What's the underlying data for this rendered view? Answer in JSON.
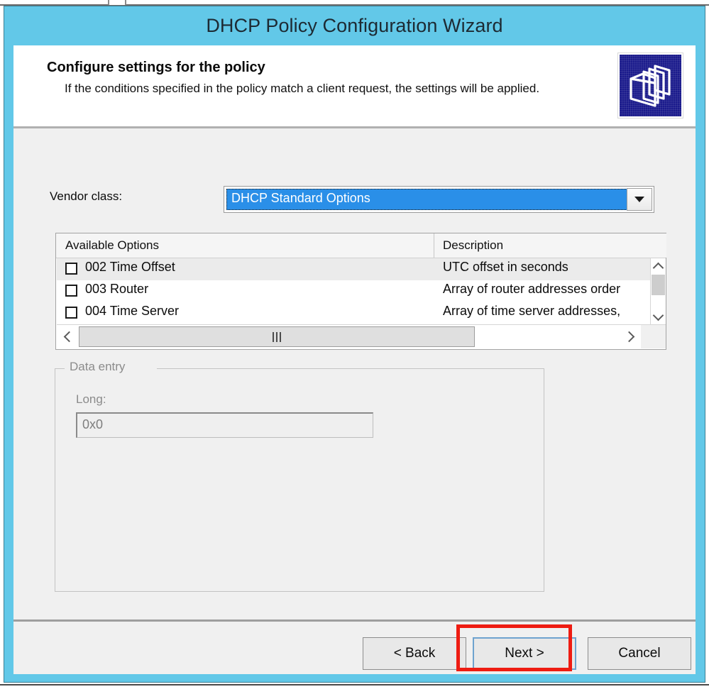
{
  "window": {
    "title": "DHCP Policy Configuration Wizard",
    "frame_color": "#62c8e8",
    "client_bg": "#f0f0f0"
  },
  "header": {
    "title": "Configure settings for the policy",
    "subtitle": "If the conditions specified in the policy match a client request, the settings will be applied.",
    "icon": "folders-icon"
  },
  "vendor_class": {
    "label": "Vendor class:",
    "selected": "DHCP Standard Options",
    "dropdown_icon": "chevron-down-icon",
    "selection_bg": "#2a8fe8",
    "selection_fg": "#ffffff"
  },
  "options_list": {
    "columns": [
      "Available Options",
      "Description"
    ],
    "rows": [
      {
        "checked": false,
        "name": "002 Time Offset",
        "description": "UTC offset in seconds",
        "selected": true
      },
      {
        "checked": false,
        "name": "003 Router",
        "description": "Array of router addresses order",
        "selected": false
      },
      {
        "checked": false,
        "name": "004 Time Server",
        "description": "Array of time server addresses,",
        "selected": false
      }
    ],
    "vertical_scrollbar": {
      "up_icon": "chevron-up-icon",
      "down_icon": "chevron-down-icon"
    },
    "horizontal_scrollbar": {
      "left_icon": "chevron-left-icon",
      "right_icon": "chevron-right-icon",
      "grip_icon": "grip-lines-icon"
    }
  },
  "data_entry": {
    "legend": "Data entry",
    "field_label": "Long:",
    "field_value": "0x0",
    "disabled": true
  },
  "footer": {
    "back_label": "< Back",
    "next_label": "Next >",
    "cancel_label": "Cancel",
    "default_button": "Next >"
  },
  "annotation": {
    "highlight_target": "Next >",
    "color": "#ee1c12"
  }
}
